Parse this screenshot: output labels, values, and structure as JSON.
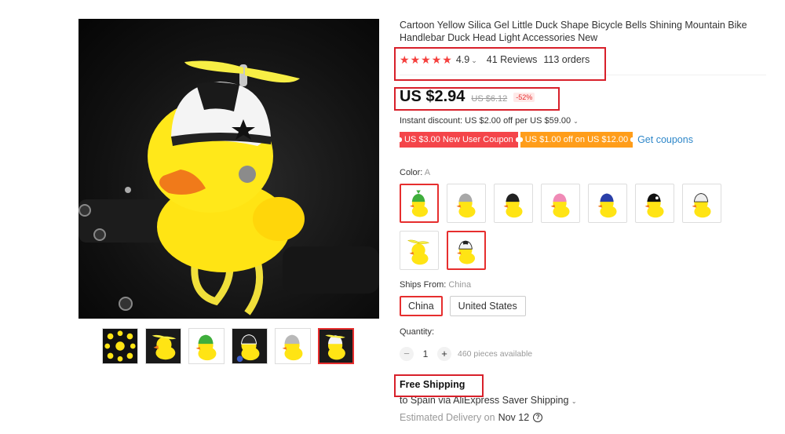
{
  "product": {
    "title": "Cartoon Yellow Silica Gel Little Duck Shape Bicycle Bells Shining Mountain Bike Handlebar Duck Head Light Accessories New",
    "rating": "4.9",
    "stars": 5,
    "reviews": "41 Reviews",
    "orders": "113 orders"
  },
  "price": {
    "current": "US $2.94",
    "original": "US $6.12",
    "discount": "-52%"
  },
  "instant_discount": "Instant discount: US $2.00 off per US $59.00",
  "coupons": [
    {
      "label": "US $3.00 New User Coupon",
      "color": "#f4454a"
    },
    {
      "label": "US $1.00 off on US $12.00",
      "color": "#ff9d1a"
    }
  ],
  "get_coupons": "Get coupons",
  "color": {
    "label": "Color:",
    "selected": "A",
    "options": [
      {
        "icon": "duck-green-helmet-icon"
      },
      {
        "icon": "duck-silver-helmet-icon"
      },
      {
        "icon": "duck-black-helmet-icon"
      },
      {
        "icon": "duck-pink-helmet-icon"
      },
      {
        "icon": "duck-blue-helmet-icon"
      },
      {
        "icon": "duck-black-helmet-icon"
      },
      {
        "icon": "duck-white-helmet-icon"
      },
      {
        "icon": "duck-propeller-icon"
      },
      {
        "icon": "duck-star-helmet-icon"
      }
    ]
  },
  "ships_from": {
    "label": "Ships From:",
    "selected": "China",
    "options": [
      "China",
      "United States"
    ]
  },
  "quantity": {
    "label": "Quantity:",
    "minus": "−",
    "value": "1",
    "plus": "+",
    "available": "460 pieces available"
  },
  "shipping": {
    "free": "Free Shipping",
    "to": "to Spain via AliExpress Saver Shipping",
    "delivery_label": "Estimated Delivery on",
    "delivery_date": "Nov 12",
    "help": "?"
  },
  "colors": {
    "accent_red": "#e62e2e",
    "link_blue": "#2e87c9",
    "annotation_red": "#d8202a"
  }
}
